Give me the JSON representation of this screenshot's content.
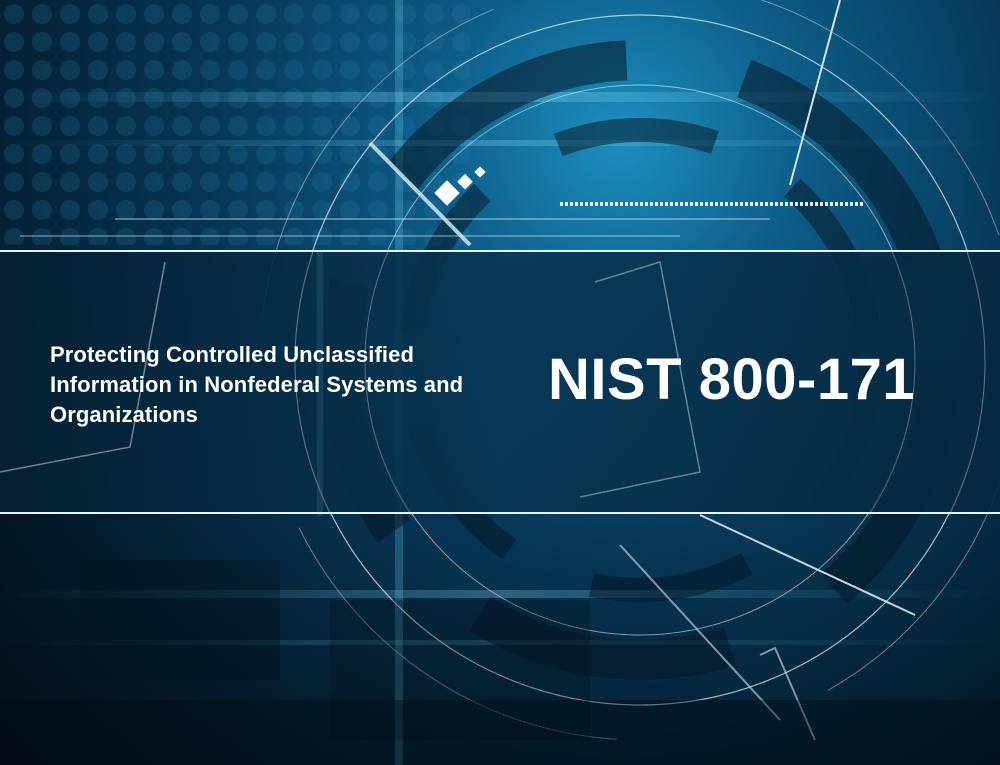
{
  "cover": {
    "subtitle": "Protecting Controlled Unclassified Information in Nonfederal Systems and Organizations",
    "title": "NIST 800-171"
  },
  "colors": {
    "background_dark": "#041a2a",
    "background_glow": "#1d8fbf",
    "band": "#083450",
    "text": "#ffffff",
    "divider": "#e8f3fb"
  }
}
